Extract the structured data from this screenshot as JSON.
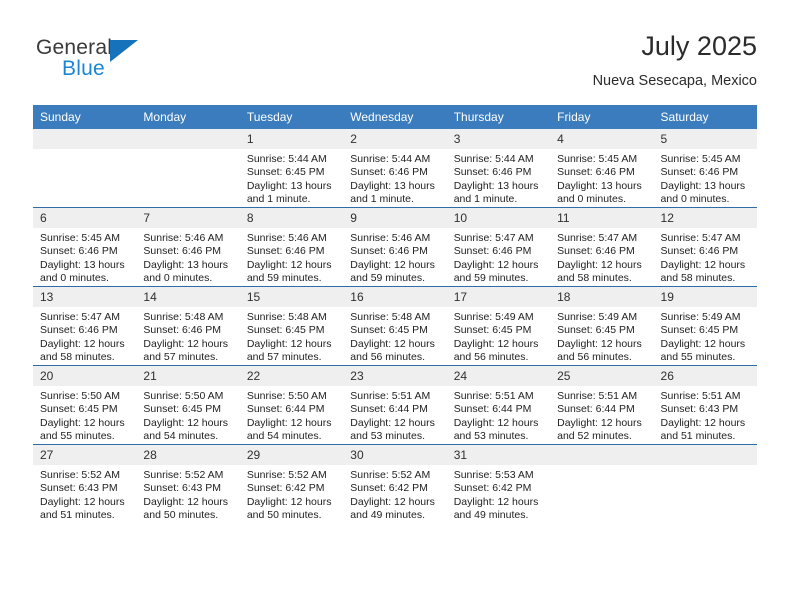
{
  "brand": {
    "name_top": "General",
    "name_bottom": "Blue",
    "accent_color": "#1672bb",
    "blue_text_color": "#1b86d4"
  },
  "header": {
    "title": "July 2025",
    "subtitle": "Nueva Sesecapa, Mexico",
    "header_bg": "#3a7cbe",
    "row_divider": "#2f6da8",
    "day_band_bg": "#efefef"
  },
  "weekday_headers": [
    "Sunday",
    "Monday",
    "Tuesday",
    "Wednesday",
    "Thursday",
    "Friday",
    "Saturday"
  ],
  "weeks": [
    [
      {
        "day": "",
        "empty": true,
        "sunrise": "",
        "sunset": "",
        "daylight_a": "",
        "daylight_b": ""
      },
      {
        "day": "",
        "empty": true,
        "sunrise": "",
        "sunset": "",
        "daylight_a": "",
        "daylight_b": ""
      },
      {
        "day": "1",
        "sunrise": "Sunrise: 5:44 AM",
        "sunset": "Sunset: 6:45 PM",
        "daylight_a": "Daylight: 13 hours",
        "daylight_b": "and 1 minute."
      },
      {
        "day": "2",
        "sunrise": "Sunrise: 5:44 AM",
        "sunset": "Sunset: 6:46 PM",
        "daylight_a": "Daylight: 13 hours",
        "daylight_b": "and 1 minute."
      },
      {
        "day": "3",
        "sunrise": "Sunrise: 5:44 AM",
        "sunset": "Sunset: 6:46 PM",
        "daylight_a": "Daylight: 13 hours",
        "daylight_b": "and 1 minute."
      },
      {
        "day": "4",
        "sunrise": "Sunrise: 5:45 AM",
        "sunset": "Sunset: 6:46 PM",
        "daylight_a": "Daylight: 13 hours",
        "daylight_b": "and 0 minutes."
      },
      {
        "day": "5",
        "sunrise": "Sunrise: 5:45 AM",
        "sunset": "Sunset: 6:46 PM",
        "daylight_a": "Daylight: 13 hours",
        "daylight_b": "and 0 minutes."
      }
    ],
    [
      {
        "day": "6",
        "sunrise": "Sunrise: 5:45 AM",
        "sunset": "Sunset: 6:46 PM",
        "daylight_a": "Daylight: 13 hours",
        "daylight_b": "and 0 minutes."
      },
      {
        "day": "7",
        "sunrise": "Sunrise: 5:46 AM",
        "sunset": "Sunset: 6:46 PM",
        "daylight_a": "Daylight: 13 hours",
        "daylight_b": "and 0 minutes."
      },
      {
        "day": "8",
        "sunrise": "Sunrise: 5:46 AM",
        "sunset": "Sunset: 6:46 PM",
        "daylight_a": "Daylight: 12 hours",
        "daylight_b": "and 59 minutes."
      },
      {
        "day": "9",
        "sunrise": "Sunrise: 5:46 AM",
        "sunset": "Sunset: 6:46 PM",
        "daylight_a": "Daylight: 12 hours",
        "daylight_b": "and 59 minutes."
      },
      {
        "day": "10",
        "sunrise": "Sunrise: 5:47 AM",
        "sunset": "Sunset: 6:46 PM",
        "daylight_a": "Daylight: 12 hours",
        "daylight_b": "and 59 minutes."
      },
      {
        "day": "11",
        "sunrise": "Sunrise: 5:47 AM",
        "sunset": "Sunset: 6:46 PM",
        "daylight_a": "Daylight: 12 hours",
        "daylight_b": "and 58 minutes."
      },
      {
        "day": "12",
        "sunrise": "Sunrise: 5:47 AM",
        "sunset": "Sunset: 6:46 PM",
        "daylight_a": "Daylight: 12 hours",
        "daylight_b": "and 58 minutes."
      }
    ],
    [
      {
        "day": "13",
        "sunrise": "Sunrise: 5:47 AM",
        "sunset": "Sunset: 6:46 PM",
        "daylight_a": "Daylight: 12 hours",
        "daylight_b": "and 58 minutes."
      },
      {
        "day": "14",
        "sunrise": "Sunrise: 5:48 AM",
        "sunset": "Sunset: 6:46 PM",
        "daylight_a": "Daylight: 12 hours",
        "daylight_b": "and 57 minutes."
      },
      {
        "day": "15",
        "sunrise": "Sunrise: 5:48 AM",
        "sunset": "Sunset: 6:45 PM",
        "daylight_a": "Daylight: 12 hours",
        "daylight_b": "and 57 minutes."
      },
      {
        "day": "16",
        "sunrise": "Sunrise: 5:48 AM",
        "sunset": "Sunset: 6:45 PM",
        "daylight_a": "Daylight: 12 hours",
        "daylight_b": "and 56 minutes."
      },
      {
        "day": "17",
        "sunrise": "Sunrise: 5:49 AM",
        "sunset": "Sunset: 6:45 PM",
        "daylight_a": "Daylight: 12 hours",
        "daylight_b": "and 56 minutes."
      },
      {
        "day": "18",
        "sunrise": "Sunrise: 5:49 AM",
        "sunset": "Sunset: 6:45 PM",
        "daylight_a": "Daylight: 12 hours",
        "daylight_b": "and 56 minutes."
      },
      {
        "day": "19",
        "sunrise": "Sunrise: 5:49 AM",
        "sunset": "Sunset: 6:45 PM",
        "daylight_a": "Daylight: 12 hours",
        "daylight_b": "and 55 minutes."
      }
    ],
    [
      {
        "day": "20",
        "sunrise": "Sunrise: 5:50 AM",
        "sunset": "Sunset: 6:45 PM",
        "daylight_a": "Daylight: 12 hours",
        "daylight_b": "and 55 minutes."
      },
      {
        "day": "21",
        "sunrise": "Sunrise: 5:50 AM",
        "sunset": "Sunset: 6:45 PM",
        "daylight_a": "Daylight: 12 hours",
        "daylight_b": "and 54 minutes."
      },
      {
        "day": "22",
        "sunrise": "Sunrise: 5:50 AM",
        "sunset": "Sunset: 6:44 PM",
        "daylight_a": "Daylight: 12 hours",
        "daylight_b": "and 54 minutes."
      },
      {
        "day": "23",
        "sunrise": "Sunrise: 5:51 AM",
        "sunset": "Sunset: 6:44 PM",
        "daylight_a": "Daylight: 12 hours",
        "daylight_b": "and 53 minutes."
      },
      {
        "day": "24",
        "sunrise": "Sunrise: 5:51 AM",
        "sunset": "Sunset: 6:44 PM",
        "daylight_a": "Daylight: 12 hours",
        "daylight_b": "and 53 minutes."
      },
      {
        "day": "25",
        "sunrise": "Sunrise: 5:51 AM",
        "sunset": "Sunset: 6:44 PM",
        "daylight_a": "Daylight: 12 hours",
        "daylight_b": "and 52 minutes."
      },
      {
        "day": "26",
        "sunrise": "Sunrise: 5:51 AM",
        "sunset": "Sunset: 6:43 PM",
        "daylight_a": "Daylight: 12 hours",
        "daylight_b": "and 51 minutes."
      }
    ],
    [
      {
        "day": "27",
        "sunrise": "Sunrise: 5:52 AM",
        "sunset": "Sunset: 6:43 PM",
        "daylight_a": "Daylight: 12 hours",
        "daylight_b": "and 51 minutes."
      },
      {
        "day": "28",
        "sunrise": "Sunrise: 5:52 AM",
        "sunset": "Sunset: 6:43 PM",
        "daylight_a": "Daylight: 12 hours",
        "daylight_b": "and 50 minutes."
      },
      {
        "day": "29",
        "sunrise": "Sunrise: 5:52 AM",
        "sunset": "Sunset: 6:42 PM",
        "daylight_a": "Daylight: 12 hours",
        "daylight_b": "and 50 minutes."
      },
      {
        "day": "30",
        "sunrise": "Sunrise: 5:52 AM",
        "sunset": "Sunset: 6:42 PM",
        "daylight_a": "Daylight: 12 hours",
        "daylight_b": "and 49 minutes."
      },
      {
        "day": "31",
        "sunrise": "Sunrise: 5:53 AM",
        "sunset": "Sunset: 6:42 PM",
        "daylight_a": "Daylight: 12 hours",
        "daylight_b": "and 49 minutes."
      },
      {
        "day": "",
        "empty": true,
        "sunrise": "",
        "sunset": "",
        "daylight_a": "",
        "daylight_b": ""
      },
      {
        "day": "",
        "empty": true,
        "sunrise": "",
        "sunset": "",
        "daylight_a": "",
        "daylight_b": ""
      }
    ]
  ]
}
